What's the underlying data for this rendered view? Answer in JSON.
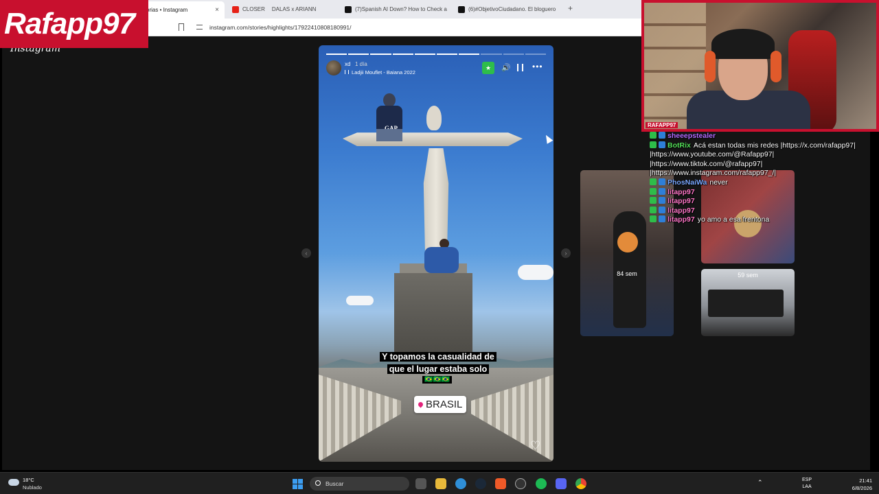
{
  "browser": {
    "tabs": [
      {
        "label": "orias • Instagram",
        "active": true
      },
      {
        "label": "CLOSER",
        "active": false
      },
      {
        "label": "DALAS x ARIANN",
        "active": false
      },
      {
        "label": "(7)Spanish AI Down? How to Check a",
        "active": false
      },
      {
        "label": "(6)#ObjetivoCiudadano. El bloguero",
        "active": false
      }
    ],
    "close_glyph": "×",
    "new_tab_glyph": "+",
    "url": "instagram.com/stories/highlights/17922410808180991/"
  },
  "page": {
    "logo_text": "Instagram"
  },
  "story": {
    "username": "xd",
    "time": "1 día",
    "music": "Ladjii Mouflet - Baiana 2022",
    "progress_done": 7,
    "progress_total": 10,
    "caption": "Y topamos la casualidad de que el lugar estaba solo",
    "flags": "🇧🇷🇧🇷🇧🇷",
    "location": "BRASIL",
    "shirt_text": "GAP",
    "star_glyph": "★",
    "volume_glyph": "🔊",
    "more_glyph": "•••",
    "heart_glyph": "♡"
  },
  "nav": {
    "prev_glyph": "‹",
    "next_glyph": "›"
  },
  "cards": [
    {
      "label": "84 sem"
    },
    {
      "label": "59 sem"
    }
  ],
  "overlay": {
    "brand": "Rafapp97",
    "webcam_tag": "RAFAPP97"
  },
  "chat": {
    "messages": [
      {
        "user": "sheeepstealer",
        "text": "",
        "user_color": "#b36bff"
      },
      {
        "user": "BotRix",
        "text": "Acá estan todas mis redes |https://x.com/rafapp97| |https://www.youtube.com/@Rafapp97| |https://www.tiktok.com/@rafapp97| |https://www.instagram.com/rafapp97_/|",
        "user_color": "#55e05a"
      },
      {
        "user": "PhosNaiWa",
        "text": "never",
        "user_color": "#7aa8ff"
      },
      {
        "user": "litapp97",
        "text": "",
        "user_color": "#ff77c8"
      },
      {
        "user": "litapp97",
        "text": "",
        "user_color": "#ff77c8"
      },
      {
        "user": "litapp97",
        "text": "",
        "user_color": "#ff77c8"
      },
      {
        "user": "litapp97",
        "text": "yo amo a esa frentona",
        "user_color": "#ff77c8"
      }
    ]
  },
  "taskbar": {
    "weather_temp": "18°C",
    "weather_desc": "Nublado",
    "search_placeholder": "Buscar",
    "lang_top": "ESP",
    "lang_bottom": "LAA",
    "time": "21:41",
    "date": "6/8/2026"
  }
}
